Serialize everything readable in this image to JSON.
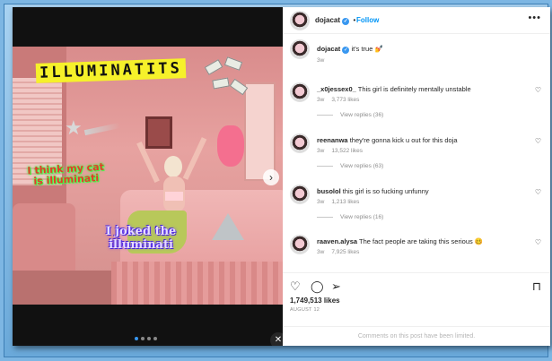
{
  "post": {
    "author": "dojacat",
    "follow_label": "Follow",
    "separator": "•",
    "more_icon": "more-horizontal-icon",
    "caption": "it's true",
    "caption_emoji": "💅",
    "caption_time": "3w"
  },
  "media": {
    "stickers": {
      "title": "ILLUMINATITS",
      "cat_text": "I think my cat is illuminati",
      "joked_text": "I joked the illuminati"
    },
    "next_icon": "chevron-right-icon",
    "mute_icon": "mute-icon",
    "dots_count": 4
  },
  "comments": [
    {
      "user": "_x0jessex0_",
      "text": "This girl is definitely mentally unstable",
      "time": "3w",
      "likes": "3,773 likes",
      "replies": "View replies (36)"
    },
    {
      "user": "reenanwa",
      "text": "they're gonna kick u out for this doja",
      "time": "3w",
      "likes": "13,522 likes",
      "replies": "View replies (63)"
    },
    {
      "user": "busolol",
      "text": "this girl is so fucking unfunny",
      "time": "3w",
      "likes": "1,213 likes",
      "replies": "View replies (16)"
    },
    {
      "user": "raaven.alysa",
      "text": "The fact people are taking this serious 🥴",
      "time": "3w",
      "likes": "7,925 likes",
      "replies": ""
    }
  ],
  "actions": {
    "like_icon": "heart-icon",
    "comment_icon": "comment-icon",
    "share_icon": "send-icon",
    "save_icon": "bookmark-icon"
  },
  "stats": {
    "likes": "1,749,513 likes",
    "date": "AUGUST 12"
  },
  "footer": {
    "limited": "Comments on this post have been limited."
  },
  "colors": {
    "accent": "#0095f6",
    "frame": "#7db6e3"
  }
}
